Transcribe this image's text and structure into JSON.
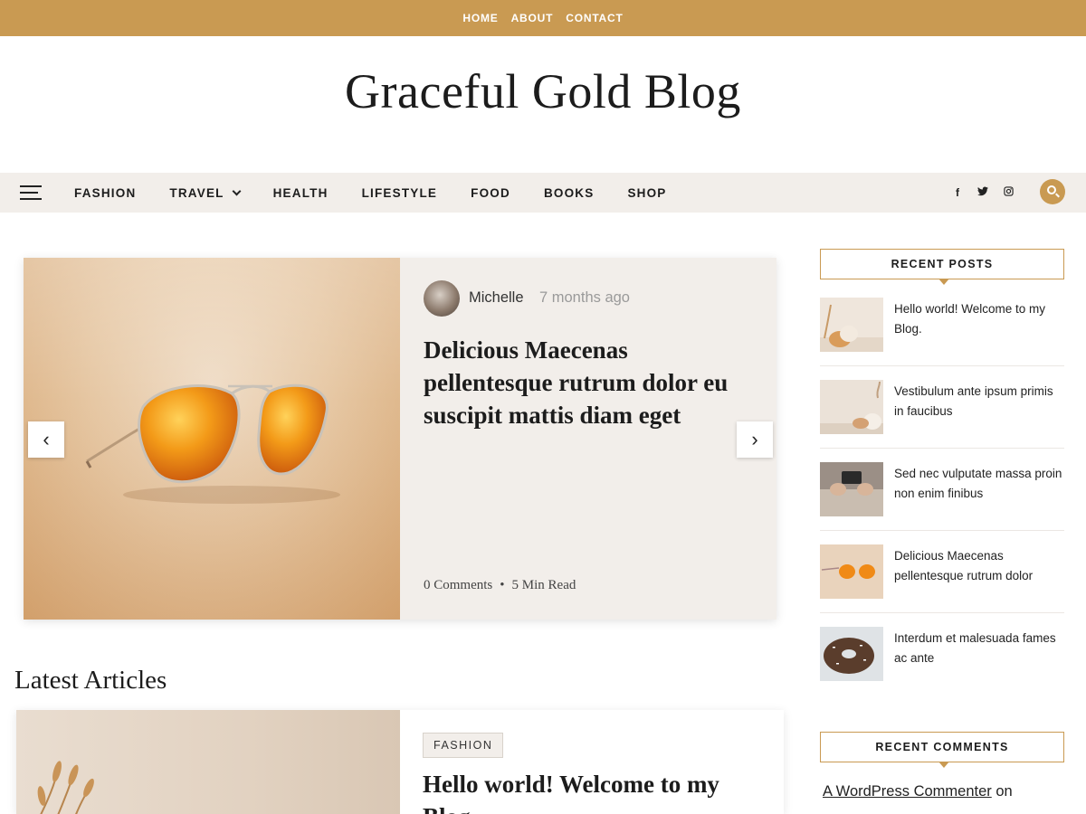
{
  "top_nav": {
    "items": [
      "HOME",
      "ABOUT",
      "CONTACT"
    ]
  },
  "site": {
    "title": "Graceful Gold Blog"
  },
  "main_nav": {
    "items": [
      "FASHION",
      "TRAVEL",
      "HEALTH",
      "LIFESTYLE",
      "FOOD",
      "BOOKS",
      "SHOP"
    ],
    "social": {
      "facebook": "f",
      "twitter": "🐦",
      "instagram": "◎"
    }
  },
  "slider": {
    "author": "Michelle",
    "time_ago": "7 months ago",
    "title": "Delicious Maecenas pellentesque rutrum dolor eu suscipit mattis diam eget",
    "comments": "0 Comments",
    "read_time": "5 Min Read",
    "prev_label": "‹",
    "next_label": "›"
  },
  "latest": {
    "heading": "Latest Articles",
    "article": {
      "category": "FASHION",
      "title": "Hello world! Welcome to my Blog"
    }
  },
  "sidebar": {
    "recent_posts": {
      "title": "RECENT POSTS",
      "items": [
        {
          "title": "Hello world! Welcome to my Blog."
        },
        {
          "title": "Vestibulum ante ipsum primis in faucibus"
        },
        {
          "title": "Sed nec vulputate massa proin non enim finibus"
        },
        {
          "title": "Delicious Maecenas pellentesque rutrum dolor"
        },
        {
          "title": "Interdum et malesuada fames ac ante"
        }
      ]
    },
    "recent_comments": {
      "title": "RECENT COMMENTS",
      "commenter": "A WordPress Commenter",
      "connector": "on"
    }
  },
  "colors": {
    "accent": "#c99a52",
    "nav_bg": "#f2eeea"
  }
}
